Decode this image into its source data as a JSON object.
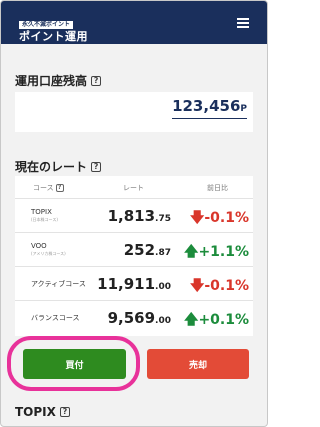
{
  "header": {
    "logo_small": "永久不滅ポイント",
    "logo_main": "ポイント運用"
  },
  "balance": {
    "title": "運用口座残高",
    "value": "123,456",
    "unit": "P"
  },
  "rates": {
    "title": "現在のレート",
    "col_course": "コース",
    "col_rate": "レート",
    "col_change": "前日比",
    "rows": [
      {
        "name": "TOPIX",
        "sub": "(日本株コース)",
        "rate_int": "1,813",
        "rate_dec": ".75",
        "arrow": "down",
        "change": "-0.1%"
      },
      {
        "name": "VOO",
        "sub": "(アメリカ株コース)",
        "rate_int": "252",
        "rate_dec": ".87",
        "arrow": "up",
        "change": "+1.1%"
      },
      {
        "name": "アクティブコース",
        "sub": "",
        "rate_int": "11,911",
        "rate_dec": ".00",
        "arrow": "down",
        "change": "-0.1%"
      },
      {
        "name": "バランスコース",
        "sub": "",
        "rate_int": "9,569",
        "rate_dec": ".00",
        "arrow": "up",
        "change": "+0.1%"
      }
    ]
  },
  "actions": {
    "buy_label": "買付",
    "sell_label": "売却"
  },
  "footer_section": {
    "title": "TOPIX"
  },
  "colors": {
    "header_bg": "#1a2f5c",
    "buy": "#2e8b1f",
    "sell": "#e34b37",
    "down": "#d9362b",
    "up": "#1c8c3c",
    "highlight": "#e8329a"
  },
  "icons": {
    "menu": "hamburger-icon",
    "help": "question-icon",
    "down": "arrow-down-icon",
    "up": "arrow-up-icon"
  }
}
